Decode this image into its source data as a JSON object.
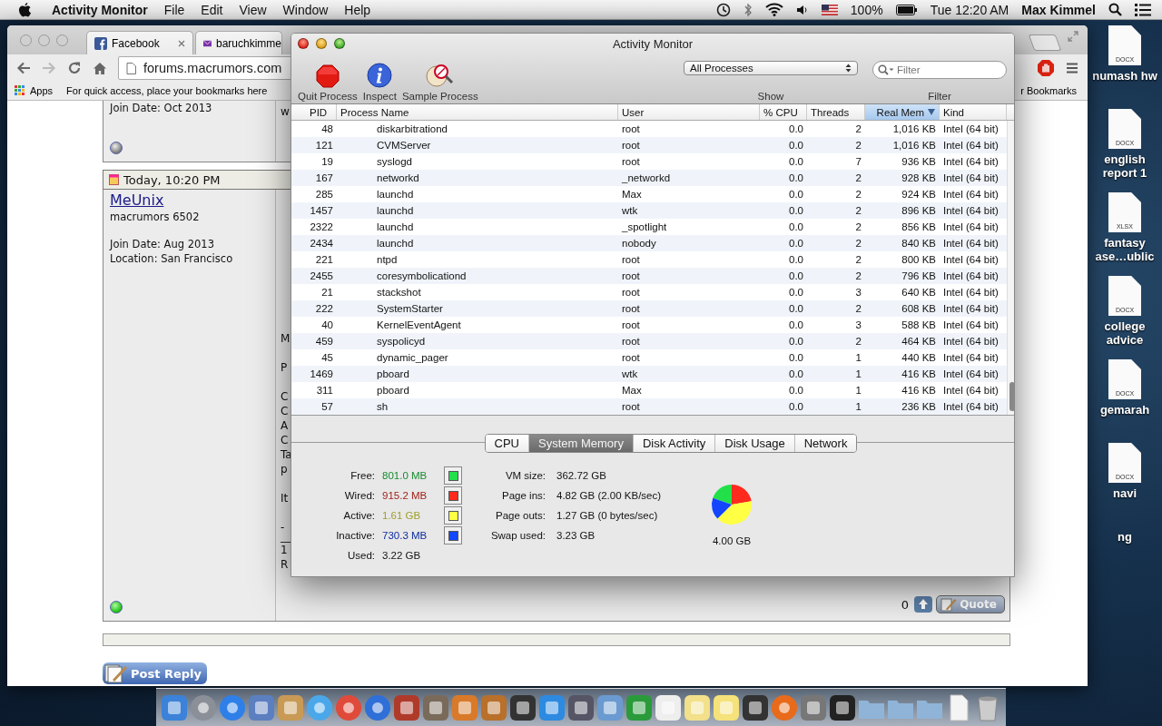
{
  "menubar": {
    "app_name": "Activity Monitor",
    "menus": [
      "File",
      "Edit",
      "View",
      "Window",
      "Help"
    ],
    "battery": "100%",
    "clock": "Tue 12:20 AM",
    "user": "Max Kimmel"
  },
  "browser": {
    "tabs": [
      {
        "title": "Facebook"
      },
      {
        "title": "baruchkimme"
      }
    ],
    "address": "forums.macrumors.com",
    "bookmarks_bar": {
      "apps": "Apps",
      "hint": "For quick access, place your bookmarks here",
      "other": "r Bookmarks"
    },
    "page": {
      "previous_post": {
        "join_date": "Join Date: Oct 2013",
        "text": "w",
        "online": false
      },
      "post": {
        "date": "Today, 10:20 PM",
        "username": "MeUnix",
        "rank": "macrumors 6502",
        "join_date": "Join Date: Aug 2013",
        "location": "Location: San Francisco",
        "online": true,
        "paragraphs": [
          [
            "M"
          ],
          [
            "P"
          ],
          [
            "C",
            "C",
            "A",
            "C",
            "Ta",
            "p"
          ],
          [
            "It"
          ],
          [
            "-"
          ]
        ],
        "signature": [
          "1",
          "R"
        ],
        "likes": "0",
        "quote": "Quote"
      },
      "post_reply": "Post Reply"
    }
  },
  "activity_monitor": {
    "title": "Activity Monitor",
    "toolbar": [
      {
        "kind": "quit",
        "label": "Quit Process"
      },
      {
        "kind": "inspect",
        "label": "Inspect"
      },
      {
        "kind": "sample",
        "label": "Sample Process"
      }
    ],
    "show": {
      "value": "All Processes",
      "label": "Show"
    },
    "filter": {
      "placeholder": "Filter",
      "label": "Filter"
    },
    "columns": [
      {
        "label": "PID",
        "selected": false
      },
      {
        "label": "Process Name",
        "selected": false
      },
      {
        "label": "User",
        "selected": false
      },
      {
        "label": "% CPU",
        "selected": false
      },
      {
        "label": "Threads",
        "selected": false
      },
      {
        "label": "Real Mem",
        "selected": true
      },
      {
        "label": "Kind",
        "selected": false
      }
    ],
    "rows": [
      {
        "pid": "48",
        "name": "diskarbitrationd",
        "user": "root",
        "cpu": "0.0",
        "threads": "2",
        "mem": "1,016 KB",
        "process_kind": "Intel (64 bit)"
      },
      {
        "pid": "121",
        "name": "CVMServer",
        "user": "root",
        "cpu": "0.0",
        "threads": "2",
        "mem": "1,016 KB",
        "process_kind": "Intel (64 bit)"
      },
      {
        "pid": "19",
        "name": "syslogd",
        "user": "root",
        "cpu": "0.0",
        "threads": "7",
        "mem": "936 KB",
        "process_kind": "Intel (64 bit)"
      },
      {
        "pid": "167",
        "name": "networkd",
        "user": "_networkd",
        "cpu": "0.0",
        "threads": "2",
        "mem": "928 KB",
        "process_kind": "Intel (64 bit)"
      },
      {
        "pid": "285",
        "name": "launchd",
        "user": "Max",
        "cpu": "0.0",
        "threads": "2",
        "mem": "924 KB",
        "process_kind": "Intel (64 bit)"
      },
      {
        "pid": "1457",
        "name": "launchd",
        "user": "wtk",
        "cpu": "0.0",
        "threads": "2",
        "mem": "896 KB",
        "process_kind": "Intel (64 bit)"
      },
      {
        "pid": "2322",
        "name": "launchd",
        "user": "_spotlight",
        "cpu": "0.0",
        "threads": "2",
        "mem": "856 KB",
        "process_kind": "Intel (64 bit)"
      },
      {
        "pid": "2434",
        "name": "launchd",
        "user": "nobody",
        "cpu": "0.0",
        "threads": "2",
        "mem": "840 KB",
        "process_kind": "Intel (64 bit)"
      },
      {
        "pid": "221",
        "name": "ntpd",
        "user": "root",
        "cpu": "0.0",
        "threads": "2",
        "mem": "800 KB",
        "process_kind": "Intel (64 bit)"
      },
      {
        "pid": "2455",
        "name": "coresymbolicationd",
        "user": "root",
        "cpu": "0.0",
        "threads": "2",
        "mem": "796 KB",
        "process_kind": "Intel (64 bit)"
      },
      {
        "pid": "21",
        "name": "stackshot",
        "user": "root",
        "cpu": "0.0",
        "threads": "3",
        "mem": "640 KB",
        "process_kind": "Intel (64 bit)"
      },
      {
        "pid": "222",
        "name": "SystemStarter",
        "user": "root",
        "cpu": "0.0",
        "threads": "2",
        "mem": "608 KB",
        "process_kind": "Intel (64 bit)"
      },
      {
        "pid": "40",
        "name": "KernelEventAgent",
        "user": "root",
        "cpu": "0.0",
        "threads": "3",
        "mem": "588 KB",
        "process_kind": "Intel (64 bit)"
      },
      {
        "pid": "459",
        "name": "syspolicyd",
        "user": "root",
        "cpu": "0.0",
        "threads": "2",
        "mem": "464 KB",
        "process_kind": "Intel (64 bit)"
      },
      {
        "pid": "45",
        "name": "dynamic_pager",
        "user": "root",
        "cpu": "0.0",
        "threads": "1",
        "mem": "440 KB",
        "process_kind": "Intel (64 bit)"
      },
      {
        "pid": "1469",
        "name": "pboard",
        "user": "wtk",
        "cpu": "0.0",
        "threads": "1",
        "mem": "416 KB",
        "process_kind": "Intel (64 bit)"
      },
      {
        "pid": "311",
        "name": "pboard",
        "user": "Max",
        "cpu": "0.0",
        "threads": "1",
        "mem": "416 KB",
        "process_kind": "Intel (64 bit)"
      },
      {
        "pid": "57",
        "name": "sh",
        "user": "root",
        "cpu": "0.0",
        "threads": "1",
        "mem": "236 KB",
        "process_kind": "Intel (64 bit)"
      }
    ],
    "tabs": [
      {
        "label": "CPU",
        "selected": false
      },
      {
        "label": "System Memory",
        "selected": true
      },
      {
        "label": "Disk Activity",
        "selected": false
      },
      {
        "label": "Disk Usage",
        "selected": false
      },
      {
        "label": "Network",
        "selected": false
      }
    ],
    "memory": {
      "legend": [
        {
          "label": "Free:",
          "value": "801.0 MB",
          "color": "#22e04a"
        },
        {
          "label": "Wired:",
          "value": "915.2 MB",
          "color": "#ff2a1e"
        },
        {
          "label": "Active:",
          "value": "1.61 GB",
          "color": "#ffff44"
        },
        {
          "label": "Inactive:",
          "value": "730.3 MB",
          "color": "#1446ff"
        }
      ],
      "used": {
        "label": "Used:",
        "value": "3.22 GB"
      },
      "vm": [
        {
          "label": "VM size:",
          "value": "362.72 GB"
        },
        {
          "label": "Page ins:",
          "value": "4.82 GB (2.00 KB/sec)"
        },
        {
          "label": "Page outs:",
          "value": "1.27 GB (0 bytes/sec)"
        },
        {
          "label": "Swap used:",
          "value": "3.23 GB"
        }
      ],
      "total": "4.00 GB",
      "chart_data": {
        "type": "pie",
        "series": [
          {
            "values": [
              19.56,
              22.35,
              40.26,
              17.83
            ]
          }
        ]
      }
    }
  },
  "desktop_icons": [
    {
      "type": "DOCX",
      "label": "numash hw"
    },
    {
      "type": "DOCX",
      "label": "english report 1"
    },
    {
      "type": "XLSX",
      "label": "fantasy ase…ublic"
    },
    {
      "type": "DOCX",
      "label": "college advice"
    },
    {
      "type": "DOCX",
      "label": "gemarah"
    },
    {
      "type": "DOCX",
      "label": "navi"
    },
    {
      "label": "ng"
    }
  ]
}
